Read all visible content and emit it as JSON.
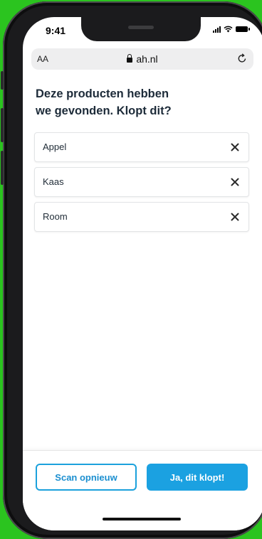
{
  "status_bar": {
    "time": "9:41"
  },
  "browser": {
    "text_size": "AA",
    "domain": "ah.nl"
  },
  "page": {
    "heading_line1": "Deze producten hebben",
    "heading_line2": "we gevonden. Klopt dit?"
  },
  "products": [
    {
      "name": "Appel"
    },
    {
      "name": "Kaas"
    },
    {
      "name": "Room"
    }
  ],
  "actions": {
    "scan_again_label": "Scan opnieuw",
    "confirm_label": "Ja, dit klopt!"
  },
  "colors": {
    "background": "#2bc41f",
    "accent": "#1ba1e1",
    "heading": "#1d2b39"
  }
}
